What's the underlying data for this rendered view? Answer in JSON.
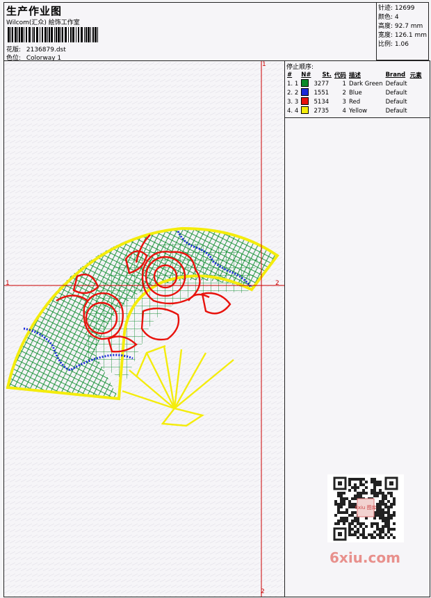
{
  "header": {
    "title": "生产作业图",
    "subtitle": "Wilcom(汇众) 絵饰工作室",
    "design_label": "花版:",
    "design_value": "2136879.dst",
    "colorway_label": "色位:",
    "colorway_value": "Colorway 1"
  },
  "stats": {
    "stitches": "针迹: 12699",
    "colors": "颜色: 4",
    "height": "高度: 92.7 mm",
    "width": "宽度: 126.1 mm",
    "scale": "比例: 1.06"
  },
  "stop_sequence": {
    "heading": "停止顺序:",
    "columns": [
      "#",
      "N#",
      "St.",
      "代码",
      "描述",
      "Brand",
      "元素"
    ],
    "rows": [
      {
        "idx": "1.",
        "n": "1",
        "color": "#0a8a2a",
        "st": "3277",
        "code": "1",
        "desc": "Dark Green",
        "brand": "Default"
      },
      {
        "idx": "2.",
        "n": "2",
        "color": "#1a2ad8",
        "st": "1551",
        "code": "2",
        "desc": "Blue",
        "brand": "Default"
      },
      {
        "idx": "3.",
        "n": "3",
        "color": "#e8120c",
        "st": "5134",
        "code": "3",
        "desc": "Red",
        "brand": "Default"
      },
      {
        "idx": "4.",
        "n": "4",
        "color": "#f4ec0c",
        "st": "2735",
        "code": "4",
        "desc": "Yellow",
        "brand": "Default"
      }
    ]
  },
  "axes": {
    "top_label": "1",
    "left_label": "1",
    "right_label": "2",
    "bottom_label": "2",
    "color": "#cc0000"
  },
  "watermark": "6xiu.com",
  "qr_badge": "6xiu 图库",
  "icons": {
    "qr": "qr-code-icon",
    "barcode": "barcode-icon"
  }
}
